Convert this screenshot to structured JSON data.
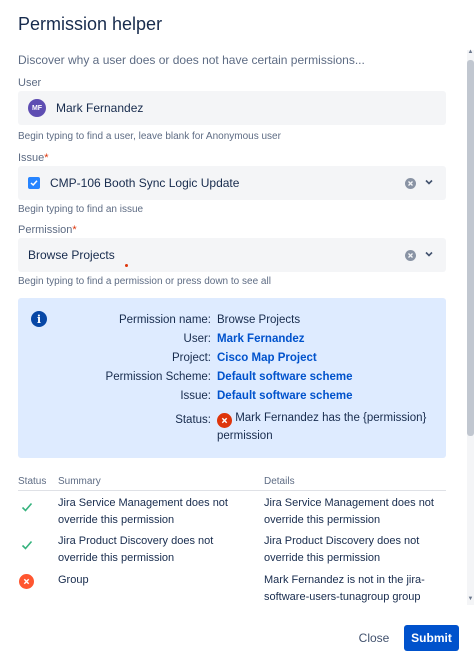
{
  "dialog": {
    "title": "Permission helper",
    "description": "Discover why a user does or does not have certain permissions..."
  },
  "user_field": {
    "label": "User",
    "avatar_initials": "MF",
    "value": "Mark Fernandez",
    "help": "Begin typing to find a user, leave blank for Anonymous user"
  },
  "issue_field": {
    "label": "Issue",
    "required_mark": "*",
    "value": "CMP-106 Booth Sync Logic Update",
    "help": "Begin typing to find an issue"
  },
  "permission_field": {
    "label": "Permission",
    "required_mark": "*",
    "value": "Browse Projects",
    "help": "Begin typing to find a permission or press down to see all"
  },
  "info": {
    "icon": "info-icon",
    "rows": [
      {
        "label": "Permission name:",
        "value": "Browse Projects"
      },
      {
        "label": "User:",
        "value": "Mark Fernandez"
      },
      {
        "label": "Project:",
        "value": "Cisco Map Project"
      },
      {
        "label": "Permission Scheme:",
        "value": "Default software scheme"
      },
      {
        "label": "Issue:",
        "value": "Default software scheme"
      }
    ],
    "status_label": "Status:",
    "status_line1": "Mark Fernandez has the {permission}",
    "status_line2": "permission"
  },
  "table": {
    "headers": [
      "Status",
      "Summary",
      "Details"
    ],
    "rows": [
      {
        "status": "ok",
        "summary": [
          "Jira Service Management does not",
          "override this permission"
        ],
        "details": [
          "Jira Service Management does not",
          "override this permission"
        ]
      },
      {
        "status": "ok",
        "summary": [
          "Jira Product Discovery does not",
          "override this permission"
        ],
        "details": [
          "Jira Product Discovery does not",
          "override this permission"
        ]
      },
      {
        "status": "fail",
        "summary": [
          "Group",
          ""
        ],
        "details": [
          "Mark Fernandez is not in the jira-",
          "software-users-tunagroup group"
        ]
      }
    ]
  },
  "footer": {
    "close_label": "Close",
    "submit_label": "Submit"
  },
  "colors": {
    "primary": "#0052cc",
    "info_bg": "#deebff",
    "success": "#36b37e",
    "error": "#de350b"
  }
}
